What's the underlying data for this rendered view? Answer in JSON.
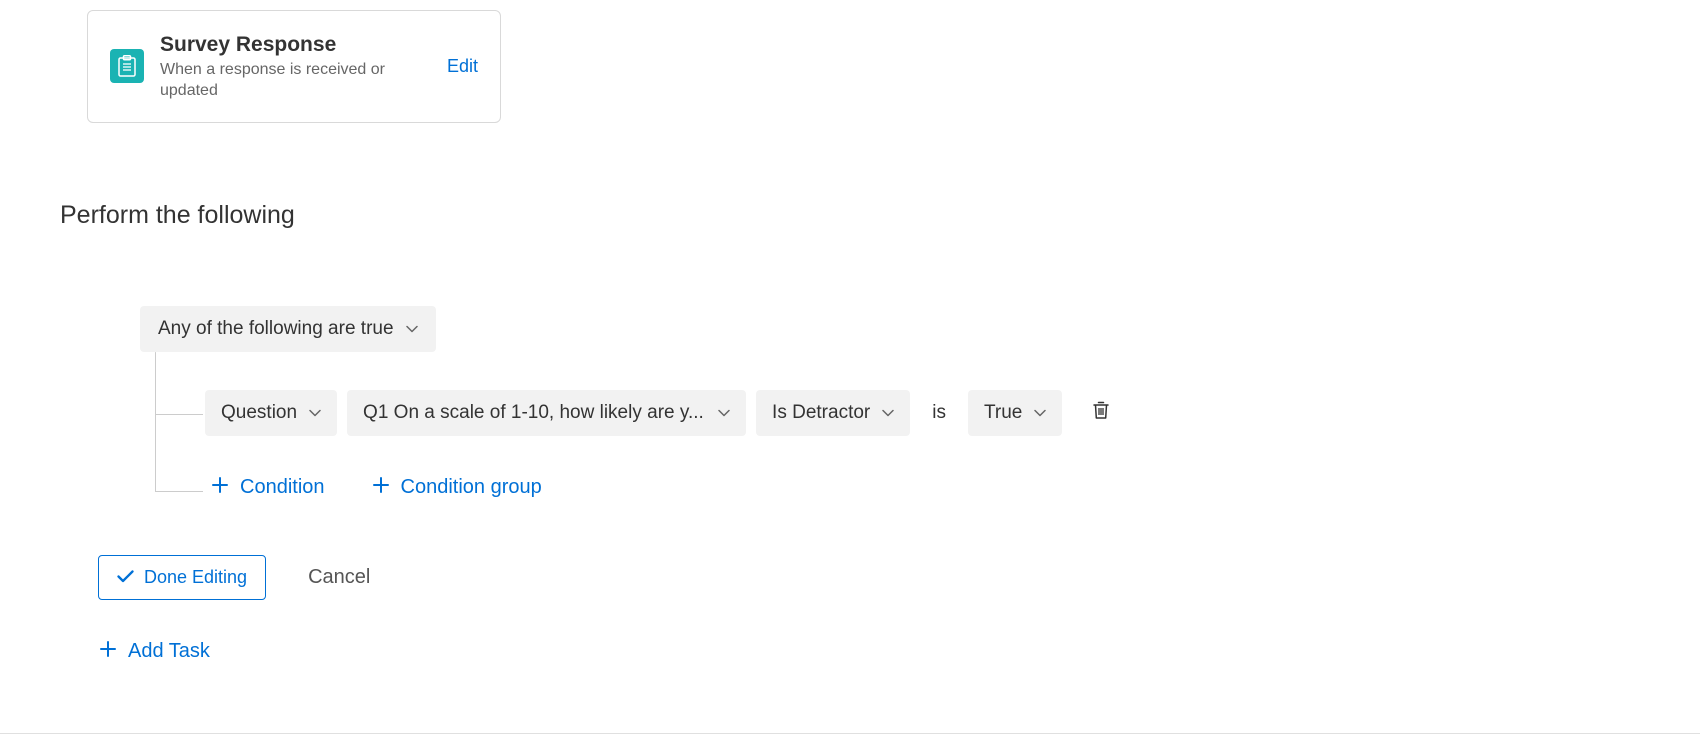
{
  "trigger": {
    "title": "Survey Response",
    "subtitle": "When a response is received or updated",
    "edit_label": "Edit"
  },
  "section_heading": "Perform the following",
  "logic": {
    "selected": "Any of the following are true"
  },
  "condition": {
    "field_type": "Question",
    "question": "Q1 On a scale of 1-10, how likely are y...",
    "operator": "Is Detractor",
    "is_text": "is",
    "value": "True"
  },
  "add": {
    "condition_label": "Condition",
    "group_label": "Condition group"
  },
  "footer": {
    "done_label": "Done Editing",
    "cancel_label": "Cancel",
    "add_task_label": "Add Task"
  },
  "icons": {
    "survey": "clipboard-icon",
    "chevron": "chevron-down-icon",
    "trash": "trash-icon",
    "check": "check-icon",
    "plus": "plus-icon"
  }
}
